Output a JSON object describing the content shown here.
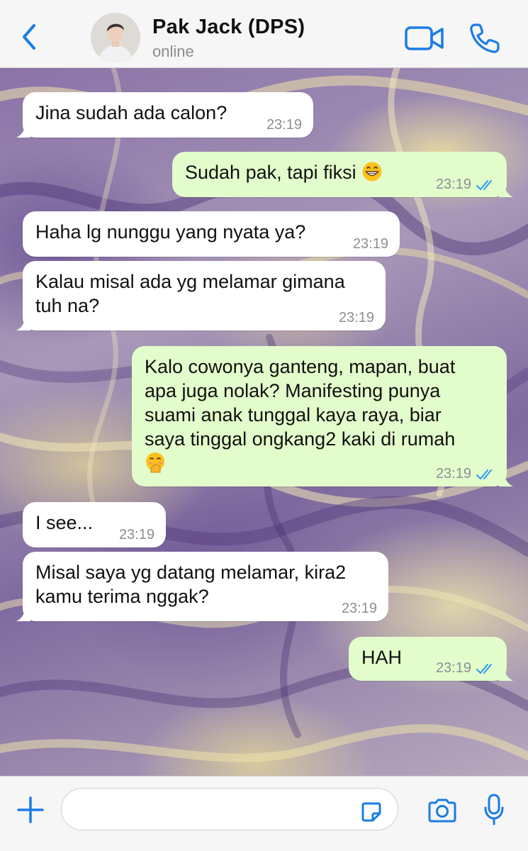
{
  "header": {
    "contact_name": "Pak Jack (DPS)",
    "status": "online",
    "icons": [
      "back-chevron-icon",
      "video-call-icon",
      "phone-icon"
    ]
  },
  "colors": {
    "accent": "#1a7ce6",
    "incoming_bubble": "#ffffff",
    "outgoing_bubble": "#e2fdcb",
    "read_ticks": "#2b9af3"
  },
  "messages": [
    {
      "direction": "in",
      "text": "Jina sudah ada calon?",
      "time": "23:19"
    },
    {
      "direction": "out",
      "text": "Sudah pak, tapi fiksi",
      "emoji": "grinning-face",
      "time": "23:19",
      "status": "read"
    },
    {
      "direction": "in",
      "text": "Haha lg nunggu yang nyata ya?",
      "time": "23:19"
    },
    {
      "direction": "in",
      "text": "Kalau misal ada yg melamar gimana\ntuh na?",
      "time": "23:19"
    },
    {
      "direction": "out",
      "text": "Kalo cowonya ganteng, mapan, buat\napa juga nolak? Manifesting punya\nsuami anak tunggal kaya raya, biar\nsaya tinggal ongkang2 kaki di rumah",
      "emoji": "face-with-hand-over-mouth",
      "time": "23:19",
      "status": "read"
    },
    {
      "direction": "in",
      "text": "I see...",
      "time": "23:19"
    },
    {
      "direction": "in",
      "text": "Misal saya yg datang melamar, kira2\nkamu terima nggak?",
      "time": "23:19"
    },
    {
      "direction": "out",
      "text": "HAH",
      "time": "23:19",
      "status": "read"
    }
  ],
  "composer": {
    "value": "",
    "icons": [
      "plus-icon",
      "sticker-icon",
      "camera-icon",
      "microphone-icon"
    ]
  }
}
